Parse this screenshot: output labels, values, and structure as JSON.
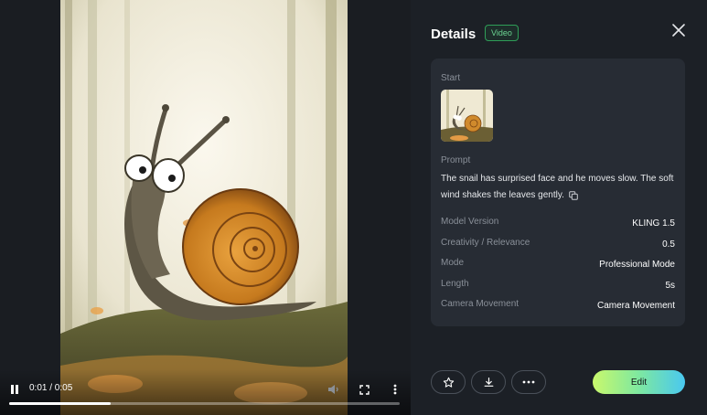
{
  "player": {
    "time_display": "0:01 / 0:05",
    "progress": 0.26
  },
  "details": {
    "title": "Details",
    "badge": "Video",
    "start_label": "Start",
    "prompt_label": "Prompt",
    "prompt_text": "The snail has surprised face and he moves slow. The soft wind shakes the leaves gently.",
    "rows": [
      {
        "label": "Model Version",
        "value": "KLING 1.5"
      },
      {
        "label": "Creativity / Relevance",
        "value": "0.5"
      },
      {
        "label": "Mode",
        "value": "Professional Mode"
      },
      {
        "label": "Length",
        "value": "5s"
      },
      {
        "label": "Camera Movement",
        "value": "Camera Movement"
      }
    ]
  },
  "actions": {
    "edit_label": "Edit"
  },
  "colors": {
    "background": "#1c2026",
    "card": "#272c34",
    "badge_green": "#6bd391",
    "edit_gradient_start": "#c9f86c",
    "edit_gradient_end": "#49c8f0"
  },
  "icons": [
    "pause-icon",
    "volume-icon",
    "fullscreen-icon",
    "more-vertical-icon",
    "close-icon",
    "copy-icon",
    "star-icon",
    "download-icon",
    "more-horizontal-icon"
  ]
}
